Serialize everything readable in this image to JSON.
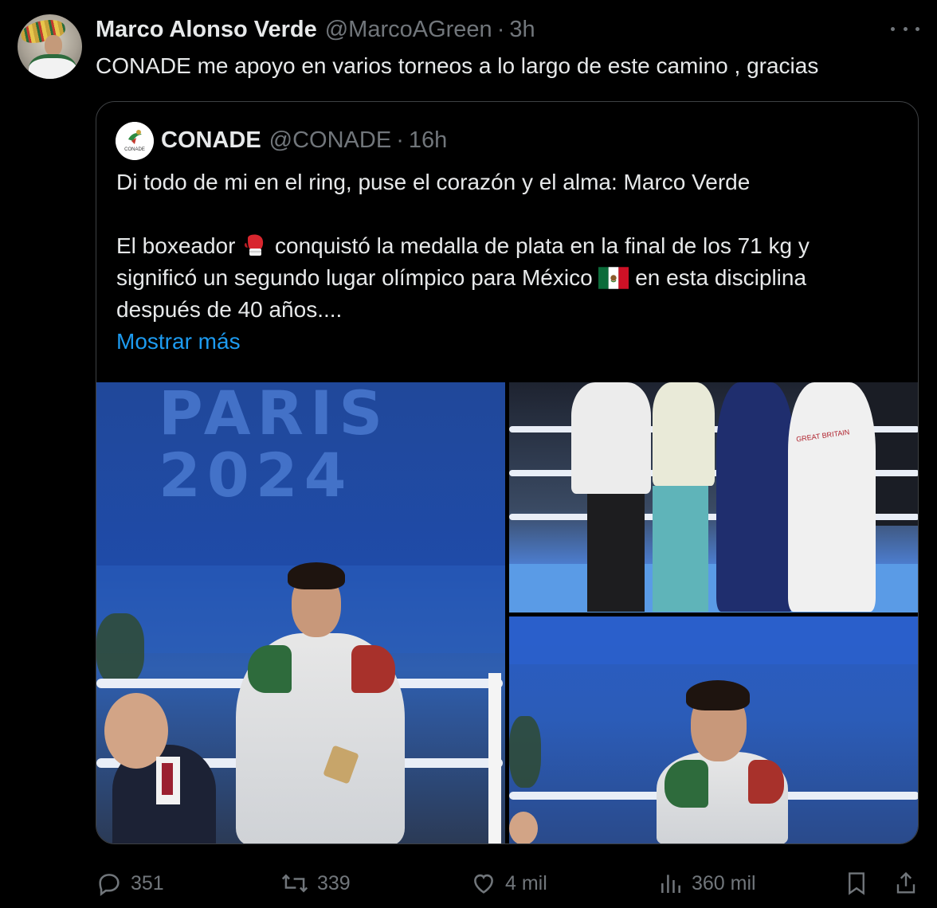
{
  "tweet": {
    "author_name": "Marco Alonso Verde",
    "author_handle": "@MarcoAGreen",
    "separator": "·",
    "time": "3h",
    "text": "CONADE me apoyo en varios torneos a lo largo de este camino , gracias"
  },
  "quoted": {
    "author_name": "CONADE",
    "author_handle": "@CONADE",
    "separator": "·",
    "time": "16h",
    "avatar_text": "CONADE",
    "line1": "Di todo de mi en el ring, puse el corazón y el alma: Marco Verde",
    "line2_a": "El boxeador",
    "line2_b": "conquistó la medalla de plata en la final de los 71 kg y",
    "line3_a": "significó un segundo lugar olímpico para México",
    "line3_b": "en esta disciplina",
    "line4": "después de 40 años....",
    "show_more": "Mostrar más",
    "photo_text": "PARIS\n2024",
    "jacket_text": "GREAT BRITAIN"
  },
  "actions": {
    "replies": "351",
    "retweets": "339",
    "likes": "4 mil",
    "views": "360 mil"
  },
  "icons": {
    "more": "more-icon",
    "reply": "reply-icon",
    "retweet": "retweet-icon",
    "like": "heart-icon",
    "views": "views-icon",
    "bookmark": "bookmark-icon",
    "share": "share-icon",
    "boxing_glove": "boxing-glove-emoji",
    "flag": "mexico-flag-emoji"
  },
  "colors": {
    "background": "#000000",
    "text": "#e7e9ea",
    "muted": "#71767b",
    "link": "#1d9bf0",
    "border": "#3e4144"
  }
}
